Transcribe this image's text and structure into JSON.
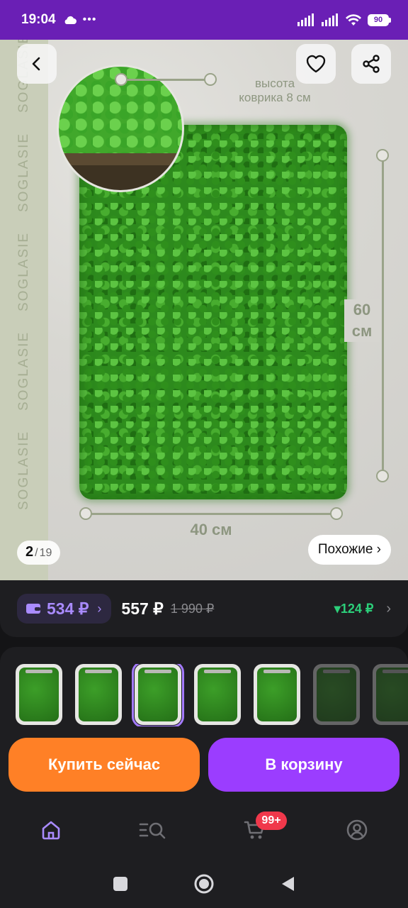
{
  "status_bar": {
    "time": "19:04",
    "dots": "•••",
    "battery": "90"
  },
  "gallery": {
    "watermark": "SOGLASIE",
    "overlay_height_text": "высота\nковрика 8 см",
    "dim_height": "60\nсм",
    "dim_width": "40 см",
    "page_current": "2",
    "page_total": "19",
    "similar_label": "Похожие ›",
    "current_index": 2,
    "total_images": 19
  },
  "price": {
    "wallet_value": "534 ₽",
    "wallet_chevron": "›",
    "price": "557 ₽",
    "old_price": "1 990 ₽",
    "cashback": "▾124 ₽",
    "cashback_chevron": "›"
  },
  "thumbnails": [
    {
      "selected": false,
      "dimmed": false
    },
    {
      "selected": false,
      "dimmed": false
    },
    {
      "selected": true,
      "dimmed": false
    },
    {
      "selected": false,
      "dimmed": false
    },
    {
      "selected": false,
      "dimmed": false
    },
    {
      "selected": false,
      "dimmed": true
    },
    {
      "selected": false,
      "dimmed": true
    }
  ],
  "actions": {
    "buy_now": "Купить сейчас",
    "add_to_cart": "В корзину"
  },
  "tabbar": {
    "cart_badge": "99+"
  },
  "colors": {
    "status_bar": "#6a1fb5",
    "accent_purple": "#9b3dff",
    "buy_orange": "#ff8026",
    "cashback_green": "#2ccf7a",
    "badge_red": "#f0384b"
  }
}
